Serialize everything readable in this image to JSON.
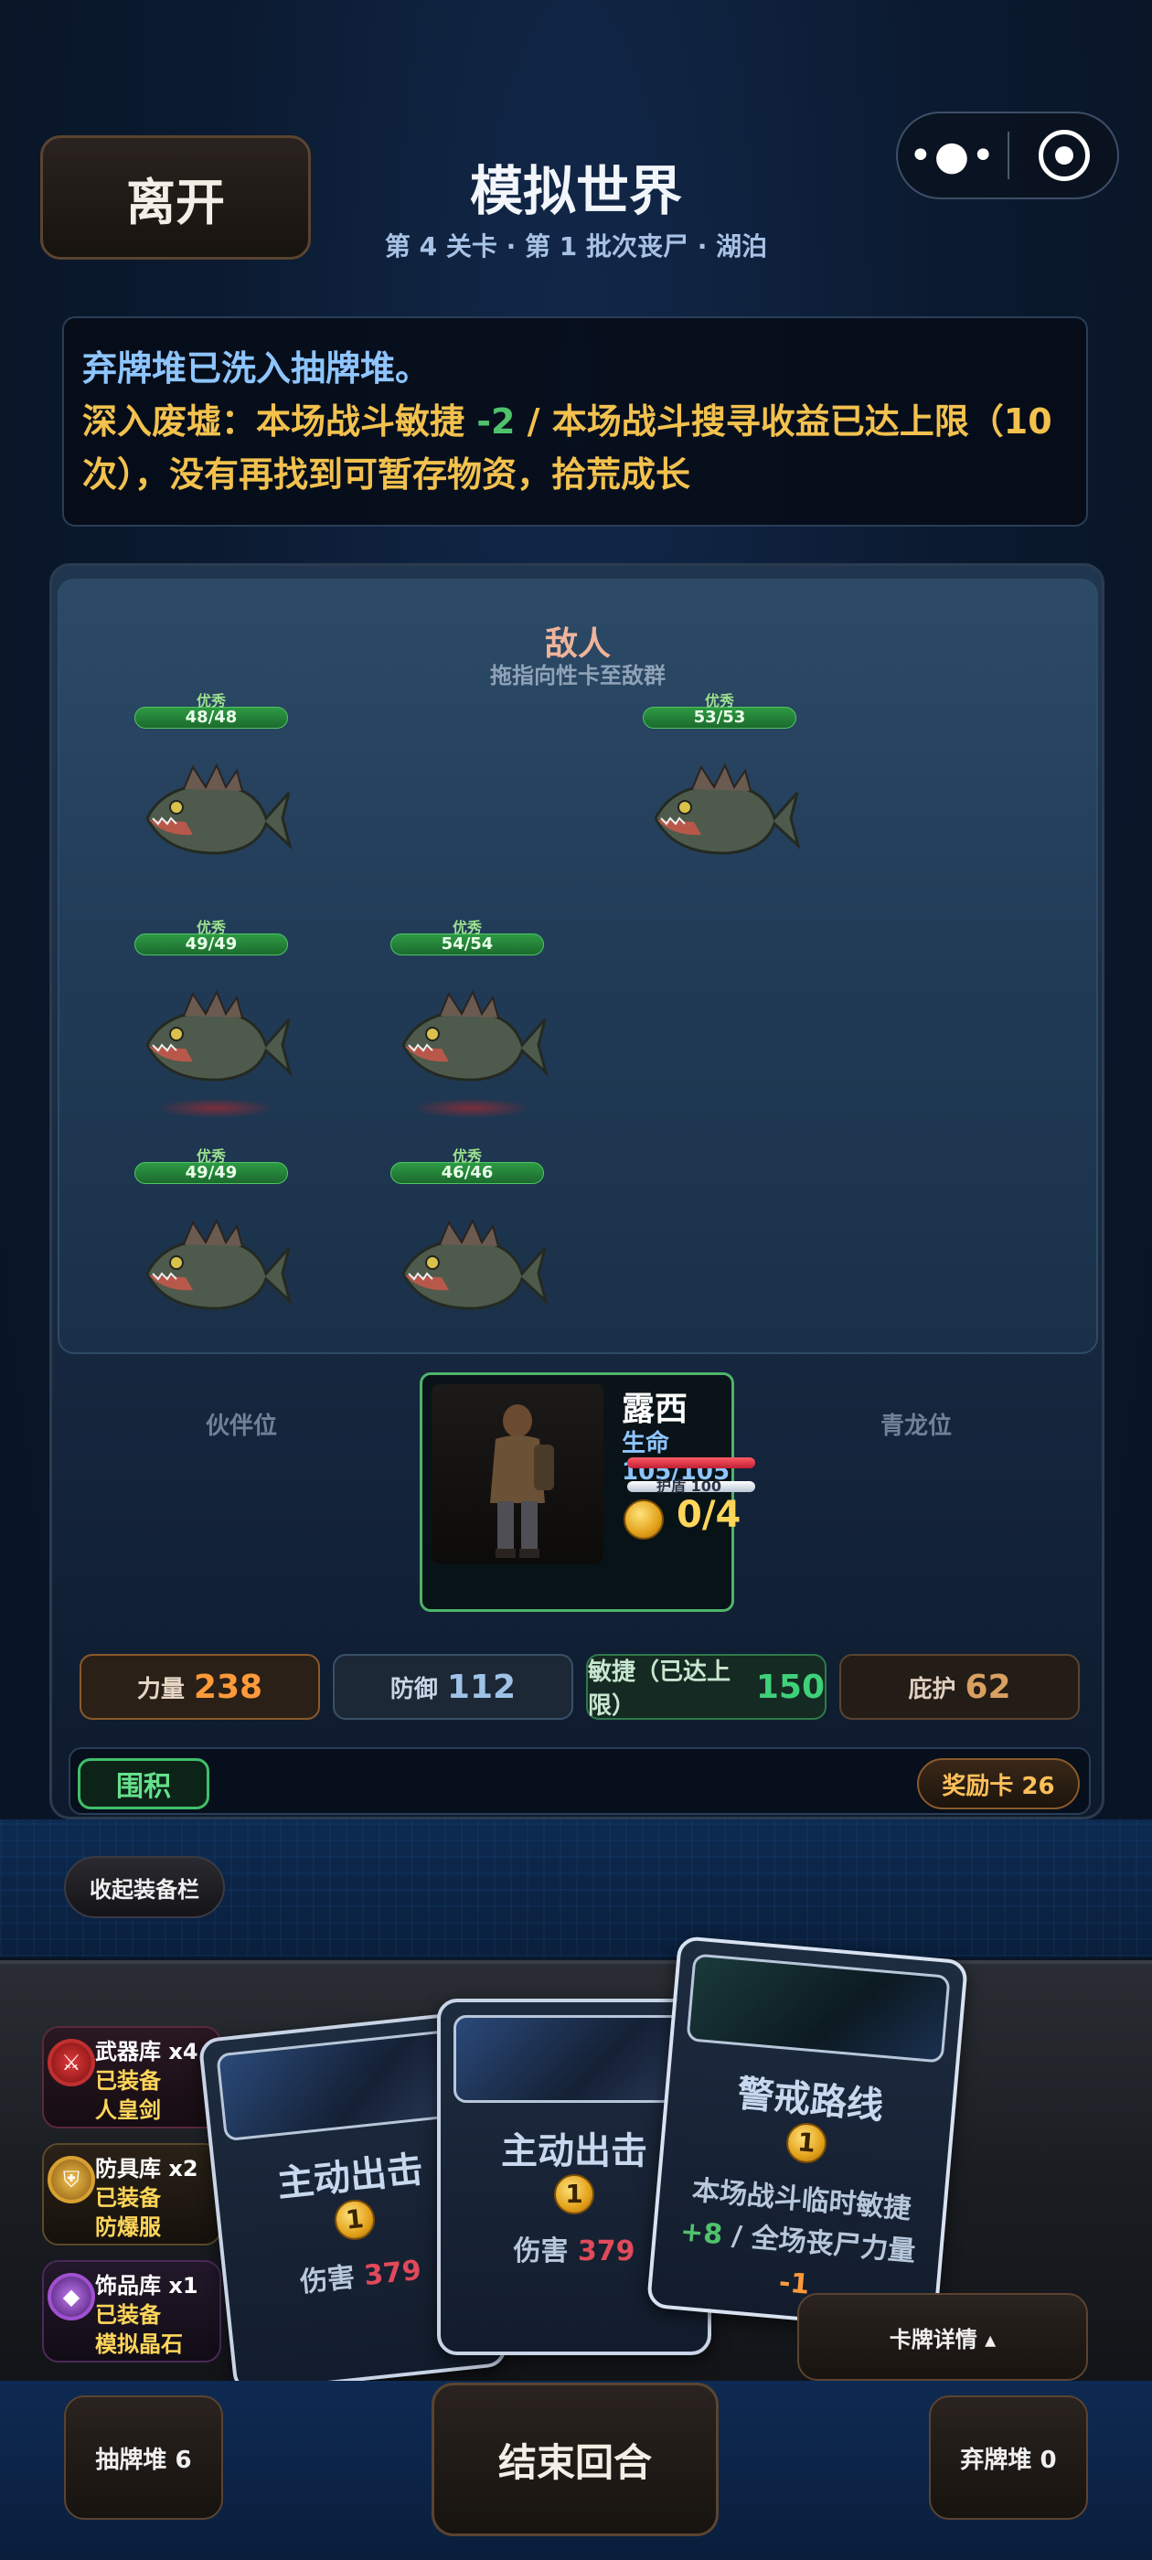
{
  "header": {
    "leave_label": "离开",
    "title": "模拟世界",
    "subtitle": "第 4 关卡 · 第 1 批次丧尸 · 湖泊",
    "more_icon": "more-dots-icon",
    "target_icon": "target-icon"
  },
  "log": {
    "line1": "弃牌堆已洗入抽牌堆。",
    "line2_a": "深入废墟：本场战斗敏捷 ",
    "line2_neg": "-2",
    "line2_b": " / 本场战斗搜寻收益已达上限（10次），没有再找到可暂存物资，拾荒成长"
  },
  "battle": {
    "enemy_title": "敌人",
    "enemy_hint": "拖指向性卡至敌群",
    "enemies": [
      {
        "tag": "优秀",
        "hp": "48/48"
      },
      {
        "tag": "优秀",
        "hp": "53/53"
      },
      {
        "tag": "优秀",
        "hp": "49/49"
      },
      {
        "tag": "优秀",
        "hp": "54/54"
      },
      {
        "tag": "优秀",
        "hp": "49/49"
      },
      {
        "tag": "优秀",
        "hp": "46/46"
      }
    ],
    "slot_left": "伙伴位",
    "slot_right": "青龙位",
    "hero": {
      "name": "露西",
      "life": "生命 105/105",
      "armor": "护盾 100",
      "energy": "0/4"
    },
    "stats": {
      "str_label": "力量",
      "str_value": "238",
      "def_label": "防御",
      "def_value": "112",
      "agi_label": "敏捷（已达上限）",
      "agi_value": "150",
      "shd_label": "庇护",
      "shd_value": "62"
    },
    "encircle_label": "围积",
    "reward_label": "奖励卡 26"
  },
  "collapse_label": "收起装备栏",
  "equipment": [
    {
      "name": "武器库 x4",
      "status": "已装备",
      "item": "人皇剑",
      "icon": "sword-icon"
    },
    {
      "name": "防具库 x2",
      "status": "已装备",
      "item": "防爆服",
      "icon": "armor-icon"
    },
    {
      "name": "饰品库 x1",
      "status": "已装备",
      "item": "模拟晶石",
      "icon": "gem-icon"
    }
  ],
  "cards": [
    {
      "name": "主动出击",
      "cost": "1",
      "desc_a": "伤害 ",
      "desc_v": "379"
    },
    {
      "name": "主动出击",
      "cost": "1",
      "desc_a": "伤害 ",
      "desc_v": "379"
    },
    {
      "name": "警戒路线",
      "cost": "1",
      "desc_a": "本场战斗临时敏捷",
      "desc_g": "+8",
      "desc_b": " / 全场丧尸力量",
      "desc_o": "-1"
    }
  ],
  "detail_label": "卡牌详情 ▴",
  "footer": {
    "draw_label": "抽牌堆 6",
    "end_label": "结束回合",
    "discard_label": "弃牌堆 0"
  },
  "colors": {
    "accent_gold": "#ffd65a",
    "hp_green": "#2e9a44",
    "agility_green": "#3fd07a"
  }
}
